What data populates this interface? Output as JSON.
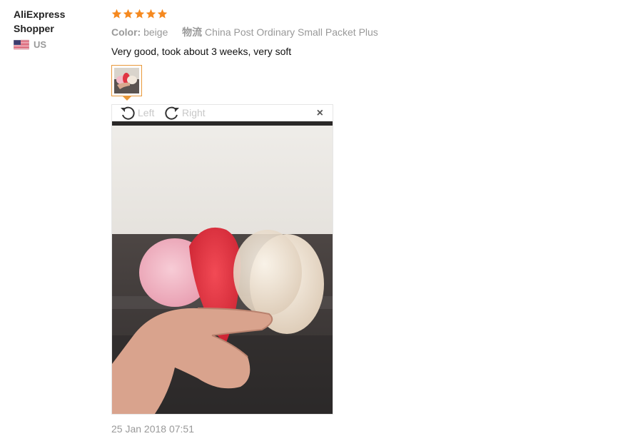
{
  "user": {
    "name": "AliExpress Shopper",
    "country_code": "US",
    "flag_icon": "us-flag-icon"
  },
  "review": {
    "rating": 5,
    "rating_max": 5,
    "star_color": "#f5891f",
    "color_label": "Color:",
    "color_value": "beige",
    "logistics_label": "物流",
    "logistics_value": "China Post Ordinary Small Packet Plus",
    "feedback": "Very good, took about 3 weeks, very soft",
    "date": "25 Jan 2018 07:51"
  },
  "viewer": {
    "rotate_left_label": "Left",
    "rotate_right_label": "Right",
    "close_label": "×",
    "accent_color": "#e8983a"
  }
}
